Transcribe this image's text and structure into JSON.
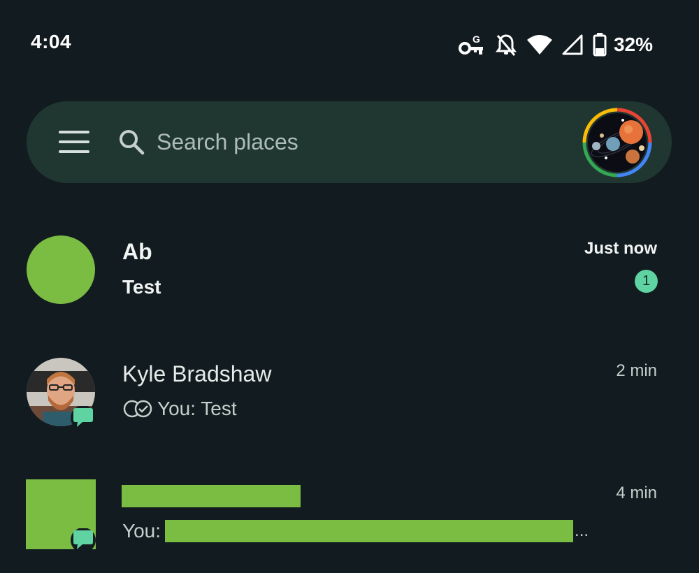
{
  "status_bar": {
    "time": "4:04",
    "battery_percent": "32%",
    "icons": [
      "vpn-key-icon",
      "notifications-off-icon",
      "wifi-icon",
      "signal-icon",
      "battery-icon"
    ]
  },
  "search": {
    "placeholder": "Search places",
    "menu_icon": "menu-icon",
    "search_icon": "search-icon"
  },
  "conversations": [
    {
      "name": "Ab",
      "snippet": "Test",
      "time": "Just now",
      "unread_count": "1",
      "avatar_color": "#7bbc43",
      "unread": true
    },
    {
      "name": "Kyle Bradshaw",
      "snippet": "You: Test",
      "time": "2 min",
      "status_icon": "read-receipt-icon",
      "badge_icon": "chat-bubble-icon",
      "unread": false
    },
    {
      "name": "",
      "snippet_prefix": "You:",
      "snippet_suffix": "...",
      "time": "4 min",
      "badge_icon": "chat-bubble-icon",
      "redacted_color": "#7bbc43",
      "unread": false
    }
  ],
  "colors": {
    "background": "#121b20",
    "search_bar": "#1f3631",
    "accent_green": "#5fd3a2",
    "redaction_green": "#7bbc43"
  }
}
